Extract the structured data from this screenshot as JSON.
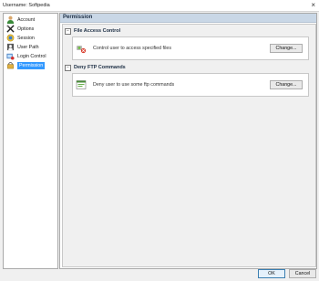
{
  "window": {
    "title": "Username: Softpedia",
    "close_glyph": "×"
  },
  "sidebar": {
    "items": [
      {
        "label": "Account",
        "icon": "account-icon",
        "selected": false
      },
      {
        "label": "Options",
        "icon": "options-icon",
        "selected": false
      },
      {
        "label": "Session",
        "icon": "session-icon",
        "selected": false
      },
      {
        "label": "User Path",
        "icon": "user-path-icon",
        "selected": false
      },
      {
        "label": "Login Control",
        "icon": "login-control-icon",
        "selected": false
      },
      {
        "label": "Permission",
        "icon": "permission-icon",
        "selected": true
      }
    ]
  },
  "main": {
    "header": "Permission",
    "sections": [
      {
        "title": "File Access Control",
        "collapse_glyph": "−",
        "description": "Control user to access specified files",
        "button": "Change...",
        "icon": "file-access-icon"
      },
      {
        "title": "Deny FTP Commands",
        "collapse_glyph": "−",
        "description": "Deny user to use some ftp commands",
        "button": "Change...",
        "icon": "ftp-commands-icon"
      }
    ]
  },
  "footer": {
    "ok": "OK",
    "cancel": "Cancel"
  },
  "colors": {
    "selection": "#3399ff",
    "header_bg": "#c9d7e6",
    "window_bg": "#f0f0f0"
  }
}
